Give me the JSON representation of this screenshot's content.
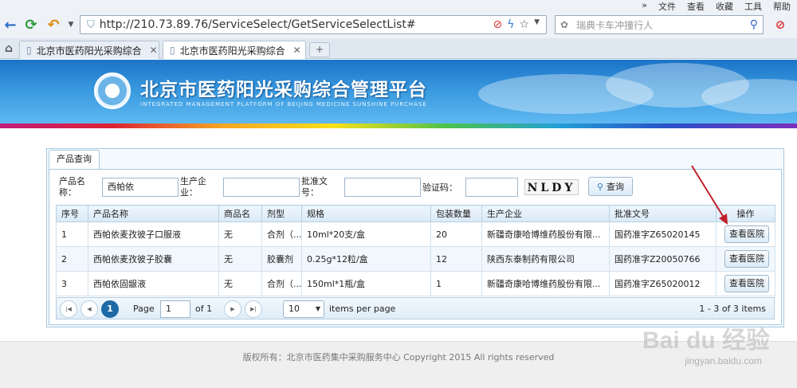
{
  "browser": {
    "menu": [
      "文件",
      "查看",
      "收藏",
      "工具",
      "帮助"
    ],
    "url": "http://210.73.89.76/ServiceSelect/GetServiceSelectList#",
    "search_placeholder": "瑞典卡车冲撞行人",
    "tabs": [
      {
        "title": "北京市医药阳光采购综合",
        "active": false
      },
      {
        "title": "北京市医药阳光采购综合",
        "active": true
      }
    ],
    "new_tab": "+"
  },
  "banner": {
    "title": "北京市医药阳光采购综合管理平台",
    "subtitle": "INTEGRATED MANAGEMENT PLATFORM OF BEIJING MEDICINE SUNSHINE PURCHASE"
  },
  "panel": {
    "tab": "产品查询",
    "form": {
      "product_name_label": "产品名称：",
      "product_name_value": "西帕依",
      "manufacturer_label": "生产企业：",
      "manufacturer_value": "",
      "approval_label": "批准文号：",
      "approval_value": "",
      "captcha_label": "验证码：",
      "captcha_value": "",
      "captcha_image": "NLDY",
      "query_button": "查询"
    },
    "table": {
      "headers": [
        "序号",
        "产品名称",
        "商品名",
        "剂型",
        "规格",
        "包装数量",
        "生产企业",
        "批准文号",
        "操作"
      ],
      "rows": [
        {
          "no": "1",
          "name": "西帕依麦孜彼子口服液",
          "trade": "无",
          "form": "合剂（...",
          "spec": "10ml*20支/盒",
          "qty": "20",
          "maker": "新疆奇康哈博维药股份有限...",
          "approval": "国药准字Z65020145",
          "action": "查看医院"
        },
        {
          "no": "2",
          "name": "西帕依麦孜彼子胶囊",
          "trade": "无",
          "form": "胶囊剂",
          "spec": "0.25g*12粒/盒",
          "qty": "12",
          "maker": "陕西东泰制药有限公司",
          "approval": "国药准字Z20050766",
          "action": "查看医院"
        },
        {
          "no": "3",
          "name": "西帕依固龈液",
          "trade": "无",
          "form": "合剂（...",
          "spec": "150ml*1瓶/盒",
          "qty": "1",
          "maker": "新疆奇康哈博维药股份有限...",
          "approval": "国药准字Z65020012",
          "action": "查看医院"
        }
      ]
    },
    "pager": {
      "current": "1",
      "page_label": "Page",
      "page_value": "1",
      "of_label": "of 1",
      "per_page_value": "10",
      "per_page_label": "items per page",
      "summary": "1 - 3 of 3 items"
    }
  },
  "footer": {
    "copyright": "版权所有：北京市医药集中采购服务中心 Copyright 2015 All rights reserved"
  },
  "watermark": {
    "logo": "Bai du 经验",
    "site": "jingyan.baidu.com"
  }
}
